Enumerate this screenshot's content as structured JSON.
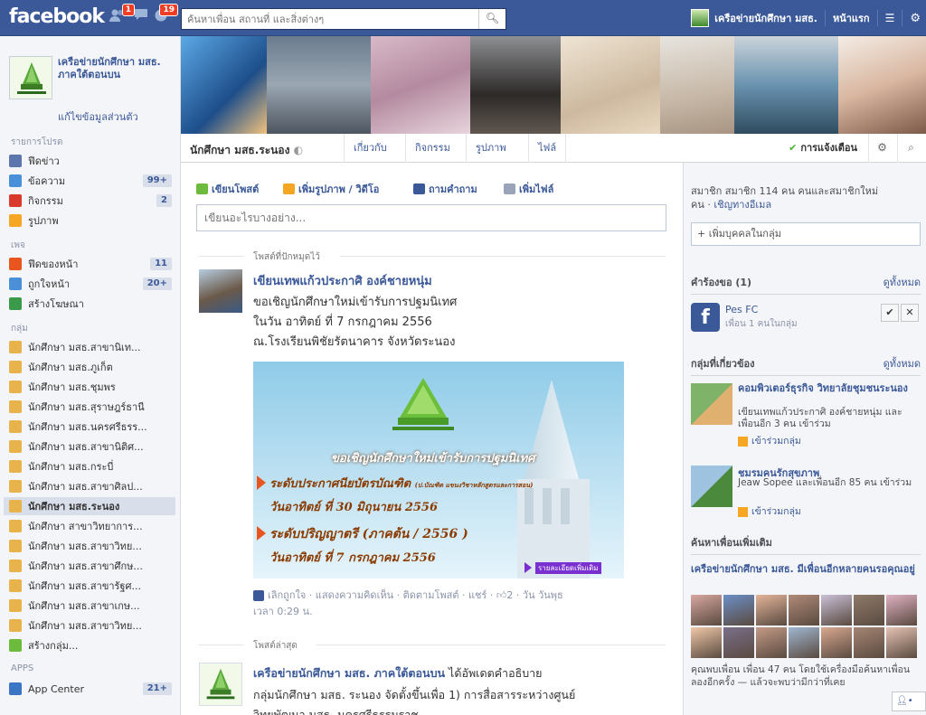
{
  "topbar": {
    "logo": "facebook",
    "friend_requests_count": "1",
    "notifications_count": "19",
    "search_placeholder": "ค้นหาเพื่อน สถานที่ และสิ่งต่างๆ",
    "user_name": "เครือข่ายนักศึกษา มสธ.",
    "home_label": "หน้าแรก"
  },
  "sidebar": {
    "profile_name": "เครือข่ายนักศึกษา มสธ. ภาคใต้ตอนบน",
    "edit_profile": "แก้ไขข้อมูลส่วนตัว",
    "favorites_header": "รายการโปรด",
    "favorites": [
      {
        "label": "ฟีดข่าว",
        "count": "",
        "icon": "news-feed-icon"
      },
      {
        "label": "ข้อความ",
        "count": "99+",
        "icon": "messages-icon"
      },
      {
        "label": "กิจกรรม",
        "count": "2",
        "icon": "events-icon"
      },
      {
        "label": "รูปภาพ",
        "count": "",
        "icon": "photos-icon"
      }
    ],
    "pages_header": "เพจ",
    "pages": [
      {
        "label": "ฟีดของหน้า",
        "count": "11",
        "icon": "pages-feed-icon"
      },
      {
        "label": "ถูกใจหน้า",
        "count": "20+",
        "icon": "like-pages-icon"
      },
      {
        "label": "สร้างโฆษณา",
        "count": "",
        "icon": "create-ad-icon"
      }
    ],
    "groups_header": "กลุ่ม",
    "groups": [
      {
        "label": "นักศึกษา มสธ.สาขานิเท...",
        "icon": "group-icon"
      },
      {
        "label": "นักศึกษา มสธ.ภูเก็ต",
        "icon": "group-icon"
      },
      {
        "label": "นักศึกษา มสธ.ชุมพร",
        "icon": "group-icon"
      },
      {
        "label": "นักศึกษา มสธ.สุราษฎร์ธานี",
        "icon": "group-icon"
      },
      {
        "label": "นักศึกษา มสธ.นครศรีธรร...",
        "icon": "group-icon"
      },
      {
        "label": "นักศึกษา มสธ.สาขานิติศ...",
        "icon": "group-icon"
      },
      {
        "label": "นักศึกษา มสธ.กระบี่",
        "icon": "group-icon"
      },
      {
        "label": "นักศึกษา มสธ.สาขาศิลป...",
        "icon": "group-icon"
      },
      {
        "label": "นักศึกษา มสธ.ระนอง",
        "icon": "group-icon"
      },
      {
        "label": "นักศึกษา สาขาวิทยาการ...",
        "icon": "group-icon"
      },
      {
        "label": "นักศึกษา มสธ.สาขาวิทย...",
        "icon": "group-icon"
      },
      {
        "label": "นักศึกษา มสธ.สาขาศึกษ...",
        "icon": "group-icon"
      },
      {
        "label": "นักศึกษา มสธ.สาขารัฐศ...",
        "icon": "group-icon"
      },
      {
        "label": "นักศึกษา มสธ.สาขาเกษ...",
        "icon": "group-icon"
      },
      {
        "label": "นักศึกษา มสธ.สาขาวิทย...",
        "icon": "group-icon"
      },
      {
        "label": "สร้างกลุ่ม...",
        "icon": "create-group-icon"
      }
    ],
    "apps_header": "APPS",
    "apps": [
      {
        "label": "App Center",
        "count": "21+",
        "icon": "app-center-icon"
      }
    ]
  },
  "group": {
    "name": "นักศึกษา มสธ.ระนอง",
    "tabs": [
      "เกี่ยวกับ",
      "กิจกรรม",
      "รูปภาพ",
      "ไฟล์"
    ],
    "notifications_label": "การแจ้งเตือน"
  },
  "composer": {
    "actions": [
      "เขียนโพสต์",
      "เพิ่มรูปภาพ / วิดีโอ",
      "ถามคำถาม",
      "เพิ่มไฟล์"
    ],
    "placeholder": "เขียนอะไรบางอย่าง..."
  },
  "pinned": {
    "label": "โพสต์ที่ปักหมุดไว้",
    "author": "เขียนเทพแก้วประกาศิ องค์ชายหนุ่ม",
    "lines": [
      "ขอเชิญนักศึกษาใหม่เข้ารับการปฐมนิเทศ",
      "ในวัน อาทิตย์ ที่ 7 กรกฎาคม 2556",
      "ณ.โรงเรียนพิชัยรัตนาคาร จังหวัดระนอง"
    ],
    "banner": {
      "headline": "ขอเชิญนักศึกษาใหม่เข้ารับการปฐมนิเทศ",
      "line1": "ระดับประกาศนียบัตรบัณฑิต",
      "line1_small": "(ป.บัณฑิต แขนงวิชาหลักสูตรและการสอน)",
      "line2": "วันอาทิตย์ ที่ 30 มิถุนายน 2556",
      "line3": "ระดับปริญญาตรี (ภาคต้น / 2556 )",
      "line4": "วันอาทิตย์ ที่ 7 กรกฎาคม 2556",
      "more": "รายละเอียดเพิ่มเติม"
    },
    "actions_line1": "เลิกถูกใจ · แสดงความคิดเห็น · ติดตามโพสต์ · แชร์ · ",
    "likes": "2",
    "actions_line1_end": " · วัน วันพุธ",
    "actions_line2": "เวลา 0:29 น."
  },
  "recent": {
    "label": "โพสต์ล่าสุด",
    "author": "เครือข่ายนักศึกษา มสธ. ภาคใต้ตอนบน",
    "author_suffix": " ได้อัพเดตคำอธิบาย",
    "line1": "กลุ่มนักศึกษา มสธ. ระนอง จัดตั้งขึ้นเพื่อ 1) การสื่อสารระหว่างศูนย์",
    "line2": "วิทยพัฒนา มสธ. นครศรีธรรมราช"
  },
  "right": {
    "members_text": "สมาชิก สมาชิก 114 คน คนและสมาชิกใหม่",
    "members_text2": "คน · ",
    "invite_link": "เชิญทางอีเมล",
    "add_people_placeholder": "+ เพิ่มบุคคลในกลุ่ม",
    "requests_header": "คำร้องขอ (1)",
    "see_all": "ดูทั้งหมด",
    "request_name": "Pes FC",
    "request_sub": "เพื่อน 1 คนในกลุ่ม",
    "related_header": "กลุ่มที่เกี่ยวข้อง",
    "related": [
      {
        "name": "คอมพิวเตอร์ธุรกิจ วิทยาลัยชุมชนระนอง",
        "desc": "เขียนเทพแก้วประกาศิ องค์ชายหนุ่ม และเพื่อนอีก 3 คน เข้าร่วม",
        "join": "เข้าร่วมกลุ่ม"
      },
      {
        "name": "ชมรมคนรักสุขภาพ",
        "desc": "Jeaw Sopee และเพื่อนอีก 85 คน เข้าร่วม",
        "join": "เข้าร่วมกลุ่ม"
      }
    ],
    "find_header": "ค้นหาเพื่อนเพิ่มเติม",
    "find_title": "เครือข่ายนักศึกษา มสธ. มีเพื่อนอีกหลายคนรอคุณอยู่",
    "find_text": "คุณพบเพื่อน เพื่อน 47 คน โดยใช้เครื่องมือค้นหาเพื่อน ลองอีกครั้ง — แล้วจะพบว่ามีกว่าที่เคย"
  }
}
